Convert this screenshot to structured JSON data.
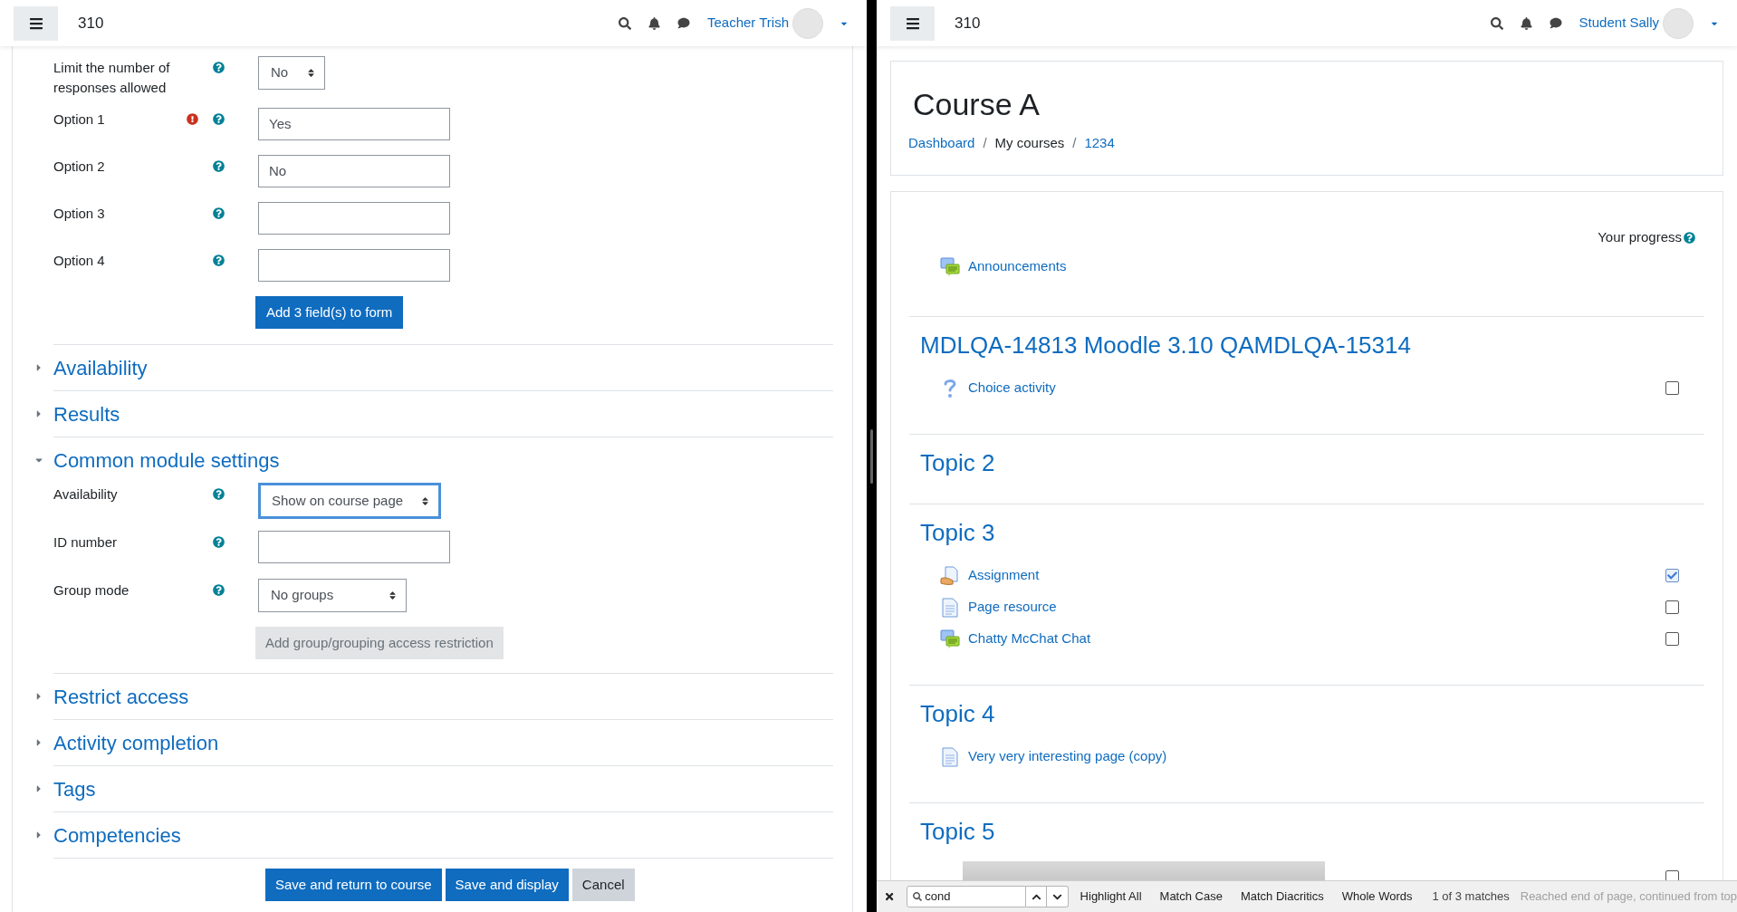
{
  "teacher_window": {
    "header": {
      "site": "310",
      "user": "Teacher Trish"
    },
    "fields": [
      {
        "label": "Limit the number of responses allowed",
        "kind": "select",
        "value": "No",
        "error": false
      },
      {
        "label": "Option 1",
        "kind": "text",
        "value": "Yes",
        "error": true
      },
      {
        "label": "Option 2",
        "kind": "text",
        "value": "No",
        "error": false
      },
      {
        "label": "Option 3",
        "kind": "text",
        "error": false
      },
      {
        "label": "Option 4",
        "kind": "text",
        "error": false
      }
    ],
    "add_fields_button": "Add 3 field(s) to form",
    "sections": [
      {
        "title": "Availability",
        "expanded": false
      },
      {
        "title": "Results",
        "expanded": false
      },
      {
        "title": "Common module settings",
        "expanded": true,
        "fields": [
          {
            "label": "Availability",
            "kind": "select",
            "value": "Show on course page",
            "focused": true
          },
          {
            "label": "ID number",
            "kind": "text",
            "focused": false
          },
          {
            "label": "Group mode",
            "kind": "select",
            "value": "No groups",
            "focused": false
          }
        ],
        "button": {
          "label": "Add group/grouping access restriction",
          "disabled": true
        }
      },
      {
        "title": "Restrict access",
        "expanded": false
      },
      {
        "title": "Activity completion",
        "expanded": false
      },
      {
        "title": "Tags",
        "expanded": false
      },
      {
        "title": "Competencies",
        "expanded": false
      }
    ],
    "buttons": [
      {
        "label": "Save and return to course",
        "kind": "primary"
      },
      {
        "label": "Save and display",
        "kind": "primary"
      },
      {
        "label": "Cancel",
        "kind": "secondary"
      }
    ]
  },
  "student_window": {
    "header": {
      "site": "310",
      "user": "Student Sally"
    },
    "page_header": {
      "title": "Course A",
      "breadcrumb": [
        {
          "label": "Dashboard",
          "kind": "link"
        },
        {
          "label": "/",
          "kind": "separator"
        },
        {
          "label": "My courses",
          "kind": "text"
        },
        {
          "label": "/",
          "kind": "separator"
        },
        {
          "label": "1234",
          "kind": "link"
        }
      ]
    },
    "progress_label": "Your progress",
    "sections": [
      {
        "items": [
          {
            "label": "Announcements",
            "kind": "forum"
          }
        ]
      },
      {
        "title": "MDLQA-14813 Moodle 3.10 QAMDLQA-15314",
        "items": [
          {
            "label": "Choice activity",
            "kind": "choice",
            "checked": false
          }
        ]
      },
      {
        "title": "Topic 2"
      },
      {
        "title": "Topic 3",
        "items": [
          {
            "label": "Assignment",
            "kind": "assign",
            "checked": true
          },
          {
            "label": "Page resource",
            "kind": "page",
            "checked": false
          },
          {
            "label": "Chatty McChat Chat",
            "kind": "forum",
            "checked": false
          }
        ]
      },
      {
        "title": "Topic 4",
        "items": [
          {
            "label": "Very very interesting page (copy)",
            "kind": "page"
          }
        ]
      },
      {
        "title": "Topic 5",
        "items": [
          {
            "kind": "image",
            "checked": false
          }
        ]
      }
    ],
    "find_bar": {
      "query": "cond",
      "options": [
        "Highlight All",
        "Match Case",
        "Match Diacritics",
        "Whole Words"
      ],
      "count": "1 of 3 matches",
      "status": "Reached end of page, continued from top"
    }
  }
}
